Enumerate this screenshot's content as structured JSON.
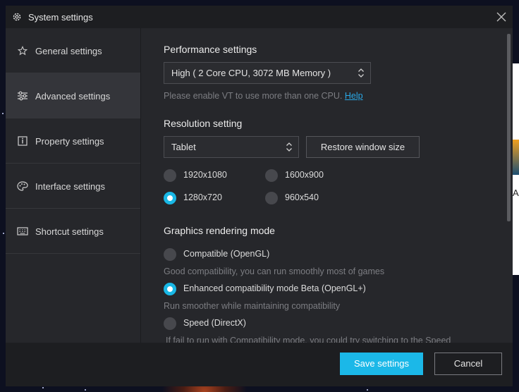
{
  "window": {
    "title": "System settings"
  },
  "sidebar": {
    "items": [
      {
        "label": "General settings",
        "icon": "star-icon"
      },
      {
        "label": "Advanced settings",
        "icon": "sliders-icon",
        "active": true
      },
      {
        "label": "Property settings",
        "icon": "info-icon"
      },
      {
        "label": "Interface settings",
        "icon": "palette-icon"
      },
      {
        "label": "Shortcut settings",
        "icon": "keyboard-icon"
      }
    ]
  },
  "performance": {
    "title": "Performance settings",
    "selected": "High ( 2 Core CPU, 3072 MB Memory )",
    "hint": "Please enable VT to use more than one CPU.",
    "help_link": "Help"
  },
  "resolution": {
    "title": "Resolution setting",
    "selected": "Tablet",
    "restore_button": "Restore window size",
    "options": [
      {
        "label": "1920x1080",
        "checked": false
      },
      {
        "label": "1600x900",
        "checked": false
      },
      {
        "label": "1280x720",
        "checked": true
      },
      {
        "label": "960x540",
        "checked": false
      }
    ]
  },
  "graphics": {
    "title": "Graphics rendering mode",
    "options": [
      {
        "label": "Compatible (OpenGL)",
        "desc": "Good compatibility, you can run smoothly most of games",
        "checked": false
      },
      {
        "label": "Enhanced compatibility mode Beta (OpenGL+)",
        "desc": "Run smoother while maintaining compatibility",
        "checked": true
      },
      {
        "label": "Speed (DirectX)",
        "desc": "If fail to run with Compatibility mode, you could try switching to the Speed",
        "checked": false
      }
    ]
  },
  "footer": {
    "save_label": "Save settings",
    "cancel_label": "Cancel"
  },
  "colors": {
    "accent": "#1bb8e8",
    "link": "#2aa8e6",
    "panel": "#26272b",
    "titlebar": "#1d1e21"
  },
  "background_app": {
    "visible_text": "Ap"
  }
}
